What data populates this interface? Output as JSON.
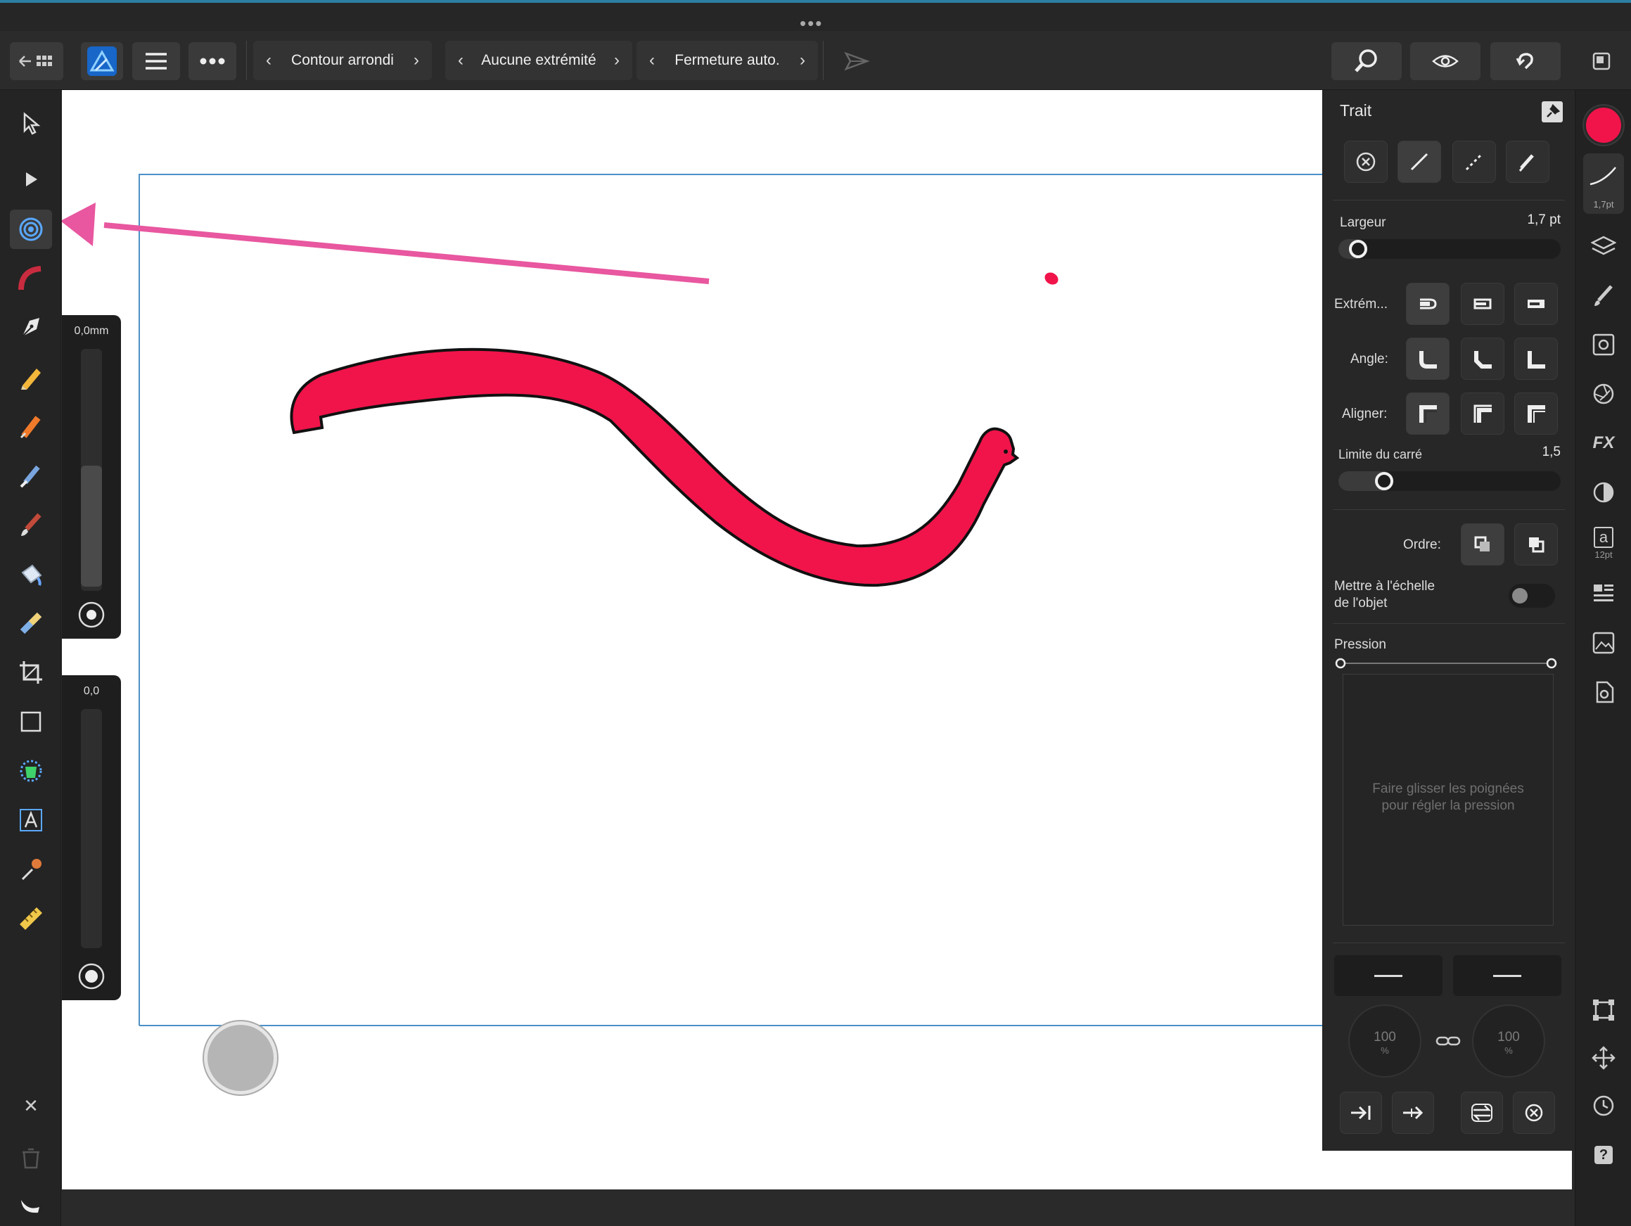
{
  "toolbar": {
    "stroke_profile": "Contour arrondi",
    "line_end": "Aucune extrémité",
    "closure": "Fermeture auto."
  },
  "left_sliders": {
    "width_value": "0,0mm",
    "smoothing_value": "0,0"
  },
  "stroke_panel": {
    "title": "Trait",
    "width_label": "Largeur",
    "width_value": "1,7 pt",
    "width_level": 0.05,
    "caps_label": "Extrém...",
    "join_label": "Angle:",
    "align_label": "Aligner:",
    "miter_label": "Limite du carré",
    "miter_value": "1,5",
    "miter_level": 0.18,
    "order_label": "Ordre:",
    "scale_label_line1": "Mettre à l'échelle",
    "scale_label_line2": "de l'objet",
    "pressure_label": "Pression",
    "pressure_hint_line1": "Faire glisser les poignées",
    "pressure_hint_line2": "pour régler la pression",
    "dial_left_value": "100",
    "dial_left_unit": "%",
    "dial_right_value": "100",
    "dial_right_unit": "%"
  },
  "studio": {
    "stroke_chip_width": "1,7pt",
    "text_size": "12pt",
    "text_glyph": "a",
    "help_glyph": "?",
    "fx_label": "FX"
  },
  "colors": {
    "fill": "#f0144a",
    "arrow": "#e8579f",
    "accent": "#2c7fa3",
    "selection": "#4a90c8"
  },
  "icons": {
    "close": "✕"
  }
}
